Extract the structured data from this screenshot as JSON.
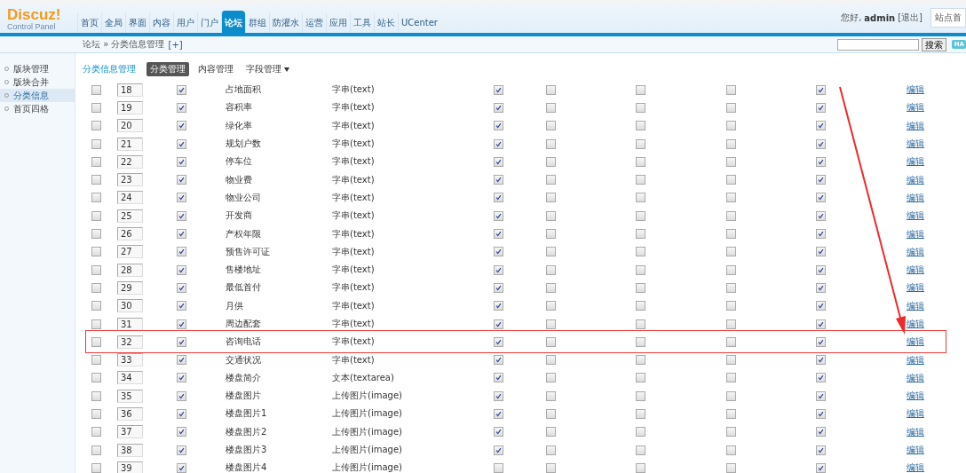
{
  "logo": {
    "name": "Discuz!",
    "subtitle": "Control Panel"
  },
  "nav": [
    {
      "label": "首页",
      "selected": false
    },
    {
      "label": "全局",
      "selected": false
    },
    {
      "label": "界面",
      "selected": false
    },
    {
      "label": "内容",
      "selected": false
    },
    {
      "label": "用户",
      "selected": false
    },
    {
      "label": "门户",
      "selected": false
    },
    {
      "label": "论坛",
      "selected": true
    },
    {
      "label": "群组",
      "selected": false
    },
    {
      "label": "防灌水",
      "selected": false
    },
    {
      "label": "运营",
      "selected": false
    },
    {
      "label": "应用",
      "selected": false
    },
    {
      "label": "工具",
      "selected": false
    },
    {
      "label": "站长",
      "selected": false
    },
    {
      "label": "UCenter",
      "selected": false
    }
  ],
  "user": {
    "greeting": "您好,",
    "name": "admin",
    "logout": "[退出]",
    "site_link": "站点首"
  },
  "breadcrumb": {
    "path": "论坛 » 分类信息管理",
    "add": "[+]"
  },
  "search": {
    "button": "搜索",
    "badge": "HA"
  },
  "sidebar": {
    "items": [
      {
        "label": "版块管理",
        "selected": false
      },
      {
        "label": "版块合并",
        "selected": false
      },
      {
        "label": "分类信息",
        "selected": true
      },
      {
        "label": "首页四格",
        "selected": false
      }
    ]
  },
  "page": {
    "title": "分类信息管理",
    "tabs": [
      {
        "label": "分类管理",
        "selected": true,
        "kind": "tab"
      },
      {
        "label": "内容管理",
        "selected": false,
        "kind": "tab"
      },
      {
        "label": "字段管理",
        "selected": false,
        "kind": "dropdown"
      }
    ]
  },
  "rows": [
    {
      "checked": false,
      "order": "18",
      "enabled": true,
      "name": "占地面积",
      "type": "字串(text)",
      "flags": [
        true,
        false,
        false,
        false,
        true
      ],
      "edit": "编辑",
      "highlighted": false
    },
    {
      "checked": false,
      "order": "19",
      "enabled": true,
      "name": "容积率",
      "type": "字串(text)",
      "flags": [
        true,
        false,
        false,
        false,
        true
      ],
      "edit": "编辑",
      "highlighted": false
    },
    {
      "checked": false,
      "order": "20",
      "enabled": true,
      "name": "绿化率",
      "type": "字串(text)",
      "flags": [
        true,
        false,
        false,
        false,
        true
      ],
      "edit": "编辑",
      "highlighted": false
    },
    {
      "checked": false,
      "order": "21",
      "enabled": true,
      "name": "规划户数",
      "type": "字串(text)",
      "flags": [
        true,
        false,
        false,
        false,
        true
      ],
      "edit": "编辑",
      "highlighted": false
    },
    {
      "checked": false,
      "order": "22",
      "enabled": true,
      "name": "停车位",
      "type": "字串(text)",
      "flags": [
        true,
        false,
        false,
        false,
        true
      ],
      "edit": "编辑",
      "highlighted": false
    },
    {
      "checked": false,
      "order": "23",
      "enabled": true,
      "name": "物业费",
      "type": "字串(text)",
      "flags": [
        true,
        false,
        false,
        false,
        true
      ],
      "edit": "编辑",
      "highlighted": false
    },
    {
      "checked": false,
      "order": "24",
      "enabled": true,
      "name": "物业公司",
      "type": "字串(text)",
      "flags": [
        true,
        false,
        false,
        false,
        true
      ],
      "edit": "编辑",
      "highlighted": false
    },
    {
      "checked": false,
      "order": "25",
      "enabled": true,
      "name": "开发商",
      "type": "字串(text)",
      "flags": [
        true,
        false,
        false,
        false,
        true
      ],
      "edit": "编辑",
      "highlighted": false
    },
    {
      "checked": false,
      "order": "26",
      "enabled": true,
      "name": "产权年限",
      "type": "字串(text)",
      "flags": [
        true,
        false,
        false,
        false,
        true
      ],
      "edit": "编辑",
      "highlighted": false
    },
    {
      "checked": false,
      "order": "27",
      "enabled": true,
      "name": "预售许可证",
      "type": "字串(text)",
      "flags": [
        true,
        false,
        false,
        false,
        true
      ],
      "edit": "编辑",
      "highlighted": false
    },
    {
      "checked": false,
      "order": "28",
      "enabled": true,
      "name": "售楼地址",
      "type": "字串(text)",
      "flags": [
        true,
        false,
        false,
        false,
        true
      ],
      "edit": "编辑",
      "highlighted": false
    },
    {
      "checked": false,
      "order": "29",
      "enabled": true,
      "name": "最低首付",
      "type": "字串(text)",
      "flags": [
        true,
        false,
        false,
        false,
        true
      ],
      "edit": "编辑",
      "highlighted": false
    },
    {
      "checked": false,
      "order": "30",
      "enabled": true,
      "name": "月供",
      "type": "字串(text)",
      "flags": [
        true,
        false,
        false,
        false,
        true
      ],
      "edit": "编辑",
      "highlighted": false
    },
    {
      "checked": false,
      "order": "31",
      "enabled": true,
      "name": "周边配套",
      "type": "字串(text)",
      "flags": [
        true,
        false,
        false,
        false,
        true
      ],
      "edit": "编辑",
      "highlighted": false
    },
    {
      "checked": false,
      "order": "32",
      "enabled": true,
      "name": "咨询电话",
      "type": "字串(text)",
      "flags": [
        true,
        false,
        false,
        false,
        true
      ],
      "edit": "编辑",
      "highlighted": true
    },
    {
      "checked": false,
      "order": "33",
      "enabled": true,
      "name": "交通状况",
      "type": "字串(text)",
      "flags": [
        true,
        false,
        false,
        false,
        true
      ],
      "edit": "编辑",
      "highlighted": false
    },
    {
      "checked": false,
      "order": "34",
      "enabled": true,
      "name": "楼盘简介",
      "type": "文本(textarea)",
      "flags": [
        true,
        false,
        false,
        false,
        true
      ],
      "edit": "编辑",
      "highlighted": false
    },
    {
      "checked": false,
      "order": "35",
      "enabled": true,
      "name": "楼盘图片",
      "type": "上传图片(image)",
      "flags": [
        true,
        false,
        false,
        false,
        true
      ],
      "edit": "编辑",
      "highlighted": false
    },
    {
      "checked": false,
      "order": "36",
      "enabled": true,
      "name": "楼盘图片1",
      "type": "上传图片(image)",
      "flags": [
        true,
        false,
        false,
        false,
        true
      ],
      "edit": "编辑",
      "highlighted": false
    },
    {
      "checked": false,
      "order": "37",
      "enabled": true,
      "name": "楼盘图片2",
      "type": "上传图片(image)",
      "flags": [
        true,
        false,
        false,
        false,
        true
      ],
      "edit": "编辑",
      "highlighted": false
    },
    {
      "checked": false,
      "order": "38",
      "enabled": true,
      "name": "楼盘图片3",
      "type": "上传图片(image)",
      "flags": [
        true,
        false,
        false,
        false,
        true
      ],
      "edit": "编辑",
      "highlighted": false
    },
    {
      "checked": false,
      "order": "39",
      "enabled": true,
      "name": "楼盘图片4",
      "type": "上传图片(image)",
      "flags": [
        false,
        false,
        false,
        false,
        true
      ],
      "edit": "编辑",
      "highlighted": false
    }
  ]
}
